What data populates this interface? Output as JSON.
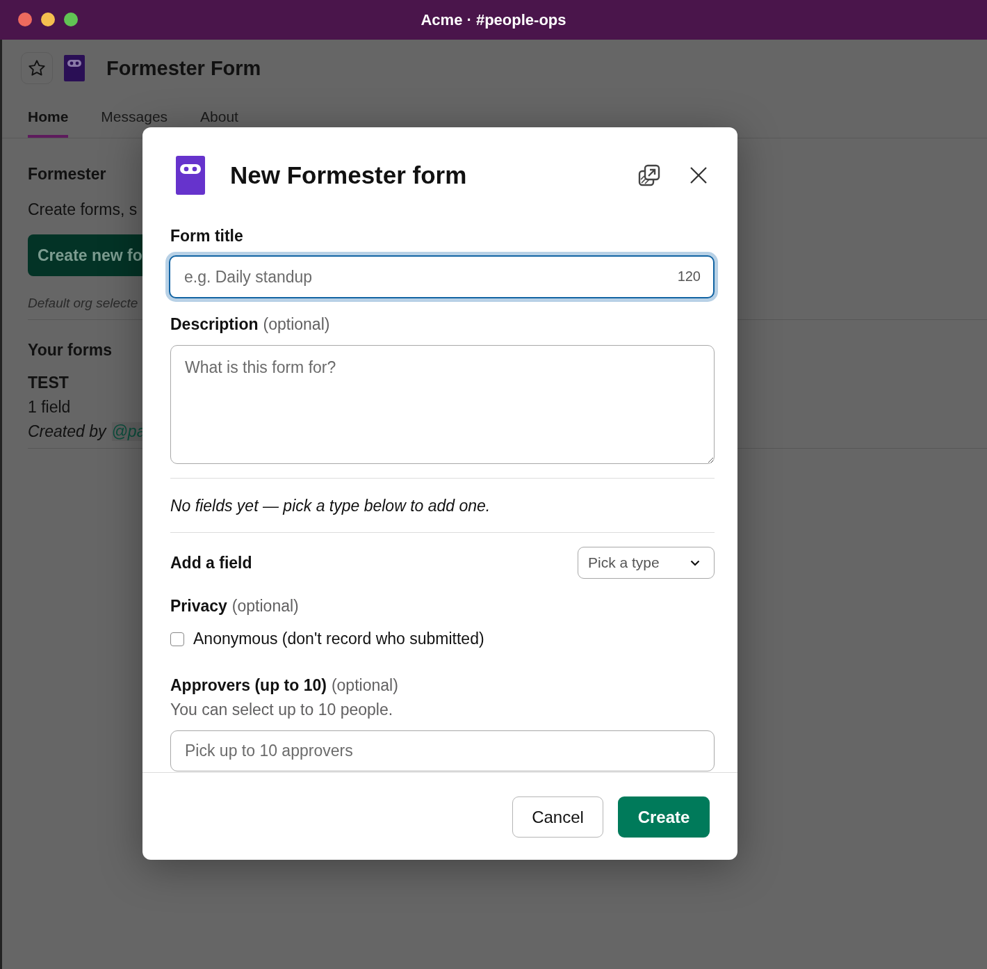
{
  "window": {
    "title": "Acme · #people-ops"
  },
  "app": {
    "title": "Formester Form"
  },
  "tabs": [
    {
      "label": "Home",
      "selected": true
    },
    {
      "label": "Messages",
      "selected": false
    },
    {
      "label": "About",
      "selected": false
    }
  ],
  "home": {
    "heading": "Formester",
    "description": "Create forms, s",
    "create_button": "Create new fo",
    "note": "Default org selecte",
    "forms_heading": "Your forms",
    "forms": [
      {
        "title": "TEST",
        "fields": "1 field",
        "created_by": "Created by",
        "mention": "@pa"
      }
    ]
  },
  "modal": {
    "title": "New Formester form",
    "form_title": {
      "label": "Form title",
      "placeholder": "e.g. Daily standup",
      "counter": "120",
      "focused": true
    },
    "description": {
      "label": "Description",
      "optional": "(optional)",
      "placeholder": "What is this form for?"
    },
    "empty_note": "No fields yet — pick a type below to add one.",
    "add_field": {
      "label": "Add a field",
      "placeholder": "Pick a type"
    },
    "privacy": {
      "label": "Privacy",
      "optional": "(optional)",
      "option": "Anonymous (don't record who submitted)",
      "checked": false
    },
    "approvers": {
      "label": "Approvers (up to 10)",
      "optional": "(optional)",
      "hint": "You can select up to 10 people.",
      "placeholder": "Pick up to 10 approvers"
    },
    "buttons": {
      "cancel": "Cancel",
      "create": "Create"
    }
  }
}
